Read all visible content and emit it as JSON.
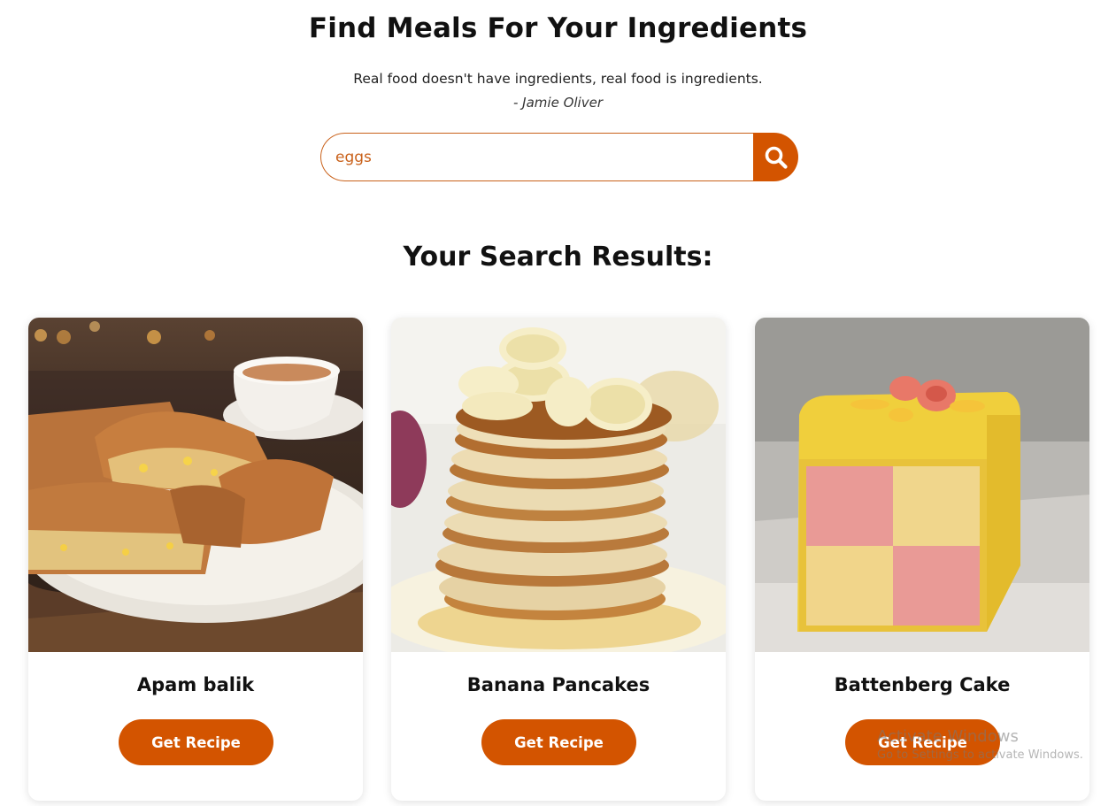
{
  "header": {
    "title": "Find Meals For Your Ingredients",
    "quote": "Real food doesn't have ingredients, real food is ingredients.",
    "author": "- Jamie Oliver"
  },
  "search": {
    "value": "eggs",
    "button_icon": "search-icon"
  },
  "results": {
    "heading": "Your Search Results:",
    "cards": [
      {
        "name": "Apam balik",
        "button_label": "Get Recipe",
        "image": "apam-balik-photo"
      },
      {
        "name": "Banana Pancakes",
        "button_label": "Get Recipe",
        "image": "banana-pancakes-photo"
      },
      {
        "name": "Battenberg Cake",
        "button_label": "Get Recipe",
        "image": "battenberg-cake-photo"
      }
    ]
  },
  "watermark": {
    "title": "Activate Windows",
    "subtitle": "Go to Settings to activate Windows."
  },
  "colors": {
    "accent": "#d35400",
    "accent_border": "#c9611a"
  }
}
